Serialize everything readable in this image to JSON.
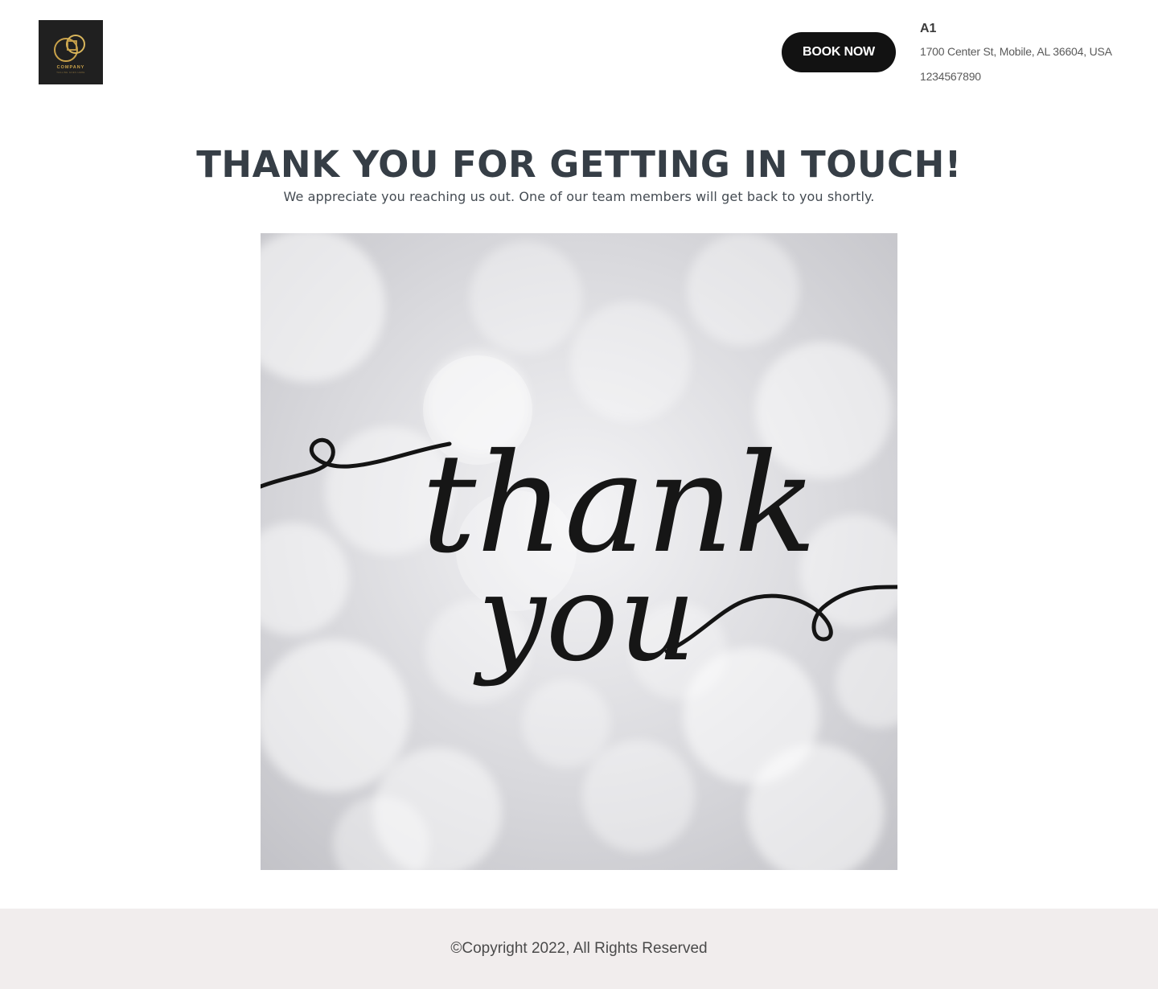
{
  "header": {
    "logo": {
      "icon": "interlocking-circle-square-logo-icon",
      "text": "COMPANY",
      "tagline": "TAGLINE GOES HERE",
      "background": "#202020",
      "accent": "#c9a24a"
    },
    "book_button_label": "BOOK NOW",
    "contact": {
      "name": "A1",
      "address": "1700 Center St, Mobile, AL 36604, USA",
      "phone": "1234567890"
    }
  },
  "main": {
    "heading": "THANK YOU FOR GETTING IN TOUCH!",
    "subheading": "We appreciate you reaching us out. One of our team members will get back to you shortly.",
    "image": {
      "line1": "thank",
      "line2": "you",
      "style": "handwritten script on silver bokeh background"
    }
  },
  "footer": {
    "copyright": "©Copyright 2022, All Rights Reserved",
    "background": "#f1eded"
  }
}
